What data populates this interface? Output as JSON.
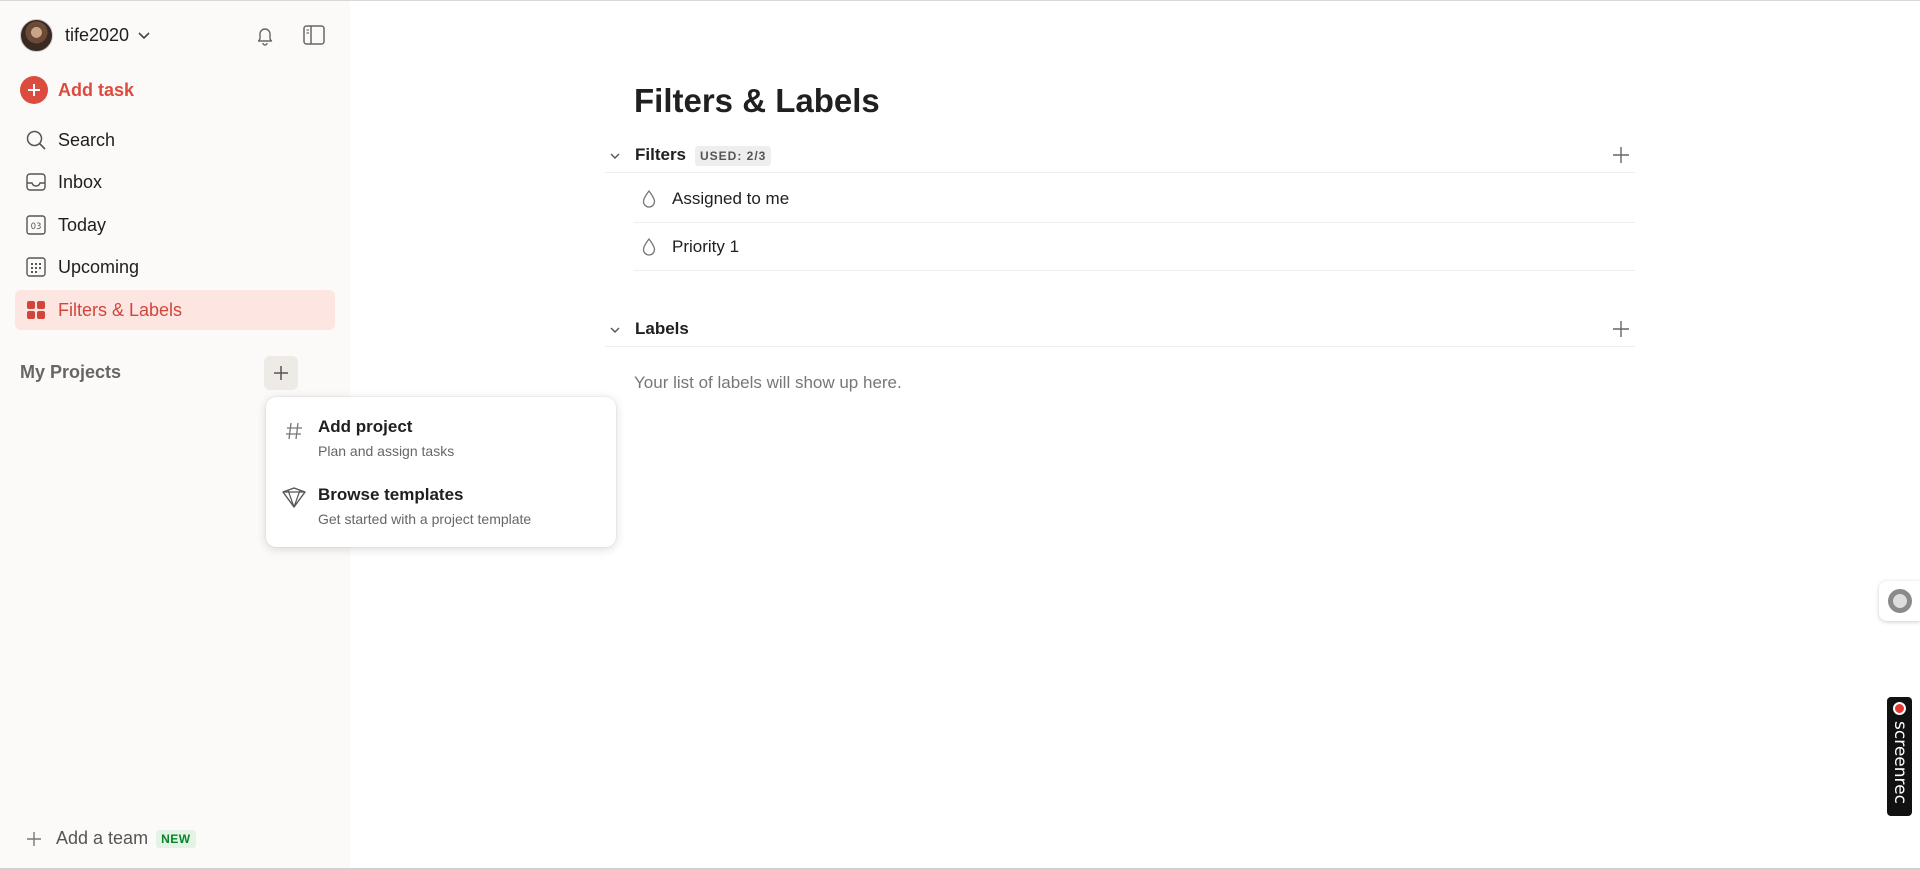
{
  "sidebar": {
    "username": "tife2020",
    "add_task_label": "Add task",
    "nav": [
      {
        "label": "Search",
        "icon": "search-icon"
      },
      {
        "label": "Inbox",
        "icon": "inbox-icon"
      },
      {
        "label": "Today",
        "icon": "calendar-today-icon",
        "day": "03"
      },
      {
        "label": "Upcoming",
        "icon": "calendar-grid-icon"
      },
      {
        "label": "Filters & Labels",
        "icon": "filters-grid-icon",
        "active": true
      }
    ],
    "my_projects_label": "My Projects",
    "add_team_label": "Add a team",
    "add_team_badge": "NEW"
  },
  "popup": {
    "items": [
      {
        "title": "Add project",
        "subtitle": "Plan and assign tasks",
        "icon": "hash-icon"
      },
      {
        "title": "Browse templates",
        "subtitle": "Get started with a project template",
        "icon": "templates-icon"
      }
    ]
  },
  "main": {
    "title": "Filters & Labels",
    "filters": {
      "title": "Filters",
      "used_badge": "USED: 2/3",
      "items": [
        {
          "label": "Assigned to me"
        },
        {
          "label": "Priority 1"
        }
      ]
    },
    "labels": {
      "title": "Labels",
      "empty_text": "Your list of labels will show up here."
    }
  },
  "overlay": {
    "screenrec_text": "screenrec"
  },
  "colors": {
    "accent": "#dc4c3e",
    "active_bg": "#fde5e1",
    "sidebar_bg": "#fcfaf8"
  }
}
